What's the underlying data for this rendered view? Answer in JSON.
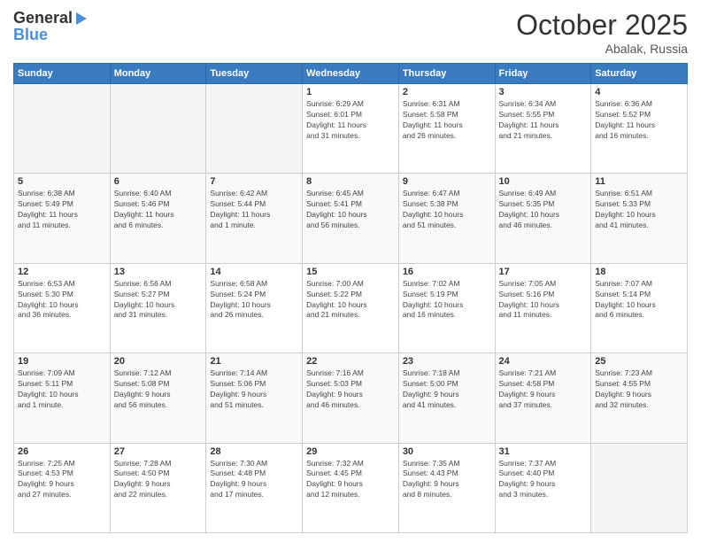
{
  "header": {
    "logo_general": "General",
    "logo_blue": "Blue",
    "month": "October 2025",
    "location": "Abalak, Russia"
  },
  "weekdays": [
    "Sunday",
    "Monday",
    "Tuesday",
    "Wednesday",
    "Thursday",
    "Friday",
    "Saturday"
  ],
  "weeks": [
    [
      {
        "day": "",
        "info": ""
      },
      {
        "day": "",
        "info": ""
      },
      {
        "day": "",
        "info": ""
      },
      {
        "day": "1",
        "info": "Sunrise: 6:29 AM\nSunset: 6:01 PM\nDaylight: 11 hours\nand 31 minutes."
      },
      {
        "day": "2",
        "info": "Sunrise: 6:31 AM\nSunset: 5:58 PM\nDaylight: 11 hours\nand 26 minutes."
      },
      {
        "day": "3",
        "info": "Sunrise: 6:34 AM\nSunset: 5:55 PM\nDaylight: 11 hours\nand 21 minutes."
      },
      {
        "day": "4",
        "info": "Sunrise: 6:36 AM\nSunset: 5:52 PM\nDaylight: 11 hours\nand 16 minutes."
      }
    ],
    [
      {
        "day": "5",
        "info": "Sunrise: 6:38 AM\nSunset: 5:49 PM\nDaylight: 11 hours\nand 11 minutes."
      },
      {
        "day": "6",
        "info": "Sunrise: 6:40 AM\nSunset: 5:46 PM\nDaylight: 11 hours\nand 6 minutes."
      },
      {
        "day": "7",
        "info": "Sunrise: 6:42 AM\nSunset: 5:44 PM\nDaylight: 11 hours\nand 1 minute."
      },
      {
        "day": "8",
        "info": "Sunrise: 6:45 AM\nSunset: 5:41 PM\nDaylight: 10 hours\nand 56 minutes."
      },
      {
        "day": "9",
        "info": "Sunrise: 6:47 AM\nSunset: 5:38 PM\nDaylight: 10 hours\nand 51 minutes."
      },
      {
        "day": "10",
        "info": "Sunrise: 6:49 AM\nSunset: 5:35 PM\nDaylight: 10 hours\nand 46 minutes."
      },
      {
        "day": "11",
        "info": "Sunrise: 6:51 AM\nSunset: 5:33 PM\nDaylight: 10 hours\nand 41 minutes."
      }
    ],
    [
      {
        "day": "12",
        "info": "Sunrise: 6:53 AM\nSunset: 5:30 PM\nDaylight: 10 hours\nand 36 minutes."
      },
      {
        "day": "13",
        "info": "Sunrise: 6:56 AM\nSunset: 5:27 PM\nDaylight: 10 hours\nand 31 minutes."
      },
      {
        "day": "14",
        "info": "Sunrise: 6:58 AM\nSunset: 5:24 PM\nDaylight: 10 hours\nand 26 minutes."
      },
      {
        "day": "15",
        "info": "Sunrise: 7:00 AM\nSunset: 5:22 PM\nDaylight: 10 hours\nand 21 minutes."
      },
      {
        "day": "16",
        "info": "Sunrise: 7:02 AM\nSunset: 5:19 PM\nDaylight: 10 hours\nand 16 minutes."
      },
      {
        "day": "17",
        "info": "Sunrise: 7:05 AM\nSunset: 5:16 PM\nDaylight: 10 hours\nand 11 minutes."
      },
      {
        "day": "18",
        "info": "Sunrise: 7:07 AM\nSunset: 5:14 PM\nDaylight: 10 hours\nand 6 minutes."
      }
    ],
    [
      {
        "day": "19",
        "info": "Sunrise: 7:09 AM\nSunset: 5:11 PM\nDaylight: 10 hours\nand 1 minute."
      },
      {
        "day": "20",
        "info": "Sunrise: 7:12 AM\nSunset: 5:08 PM\nDaylight: 9 hours\nand 56 minutes."
      },
      {
        "day": "21",
        "info": "Sunrise: 7:14 AM\nSunset: 5:06 PM\nDaylight: 9 hours\nand 51 minutes."
      },
      {
        "day": "22",
        "info": "Sunrise: 7:16 AM\nSunset: 5:03 PM\nDaylight: 9 hours\nand 46 minutes."
      },
      {
        "day": "23",
        "info": "Sunrise: 7:18 AM\nSunset: 5:00 PM\nDaylight: 9 hours\nand 41 minutes."
      },
      {
        "day": "24",
        "info": "Sunrise: 7:21 AM\nSunset: 4:58 PM\nDaylight: 9 hours\nand 37 minutes."
      },
      {
        "day": "25",
        "info": "Sunrise: 7:23 AM\nSunset: 4:55 PM\nDaylight: 9 hours\nand 32 minutes."
      }
    ],
    [
      {
        "day": "26",
        "info": "Sunrise: 7:25 AM\nSunset: 4:53 PM\nDaylight: 9 hours\nand 27 minutes."
      },
      {
        "day": "27",
        "info": "Sunrise: 7:28 AM\nSunset: 4:50 PM\nDaylight: 9 hours\nand 22 minutes."
      },
      {
        "day": "28",
        "info": "Sunrise: 7:30 AM\nSunset: 4:48 PM\nDaylight: 9 hours\nand 17 minutes."
      },
      {
        "day": "29",
        "info": "Sunrise: 7:32 AM\nSunset: 4:45 PM\nDaylight: 9 hours\nand 12 minutes."
      },
      {
        "day": "30",
        "info": "Sunrise: 7:35 AM\nSunset: 4:43 PM\nDaylight: 9 hours\nand 8 minutes."
      },
      {
        "day": "31",
        "info": "Sunrise: 7:37 AM\nSunset: 4:40 PM\nDaylight: 9 hours\nand 3 minutes."
      },
      {
        "day": "",
        "info": ""
      }
    ]
  ]
}
